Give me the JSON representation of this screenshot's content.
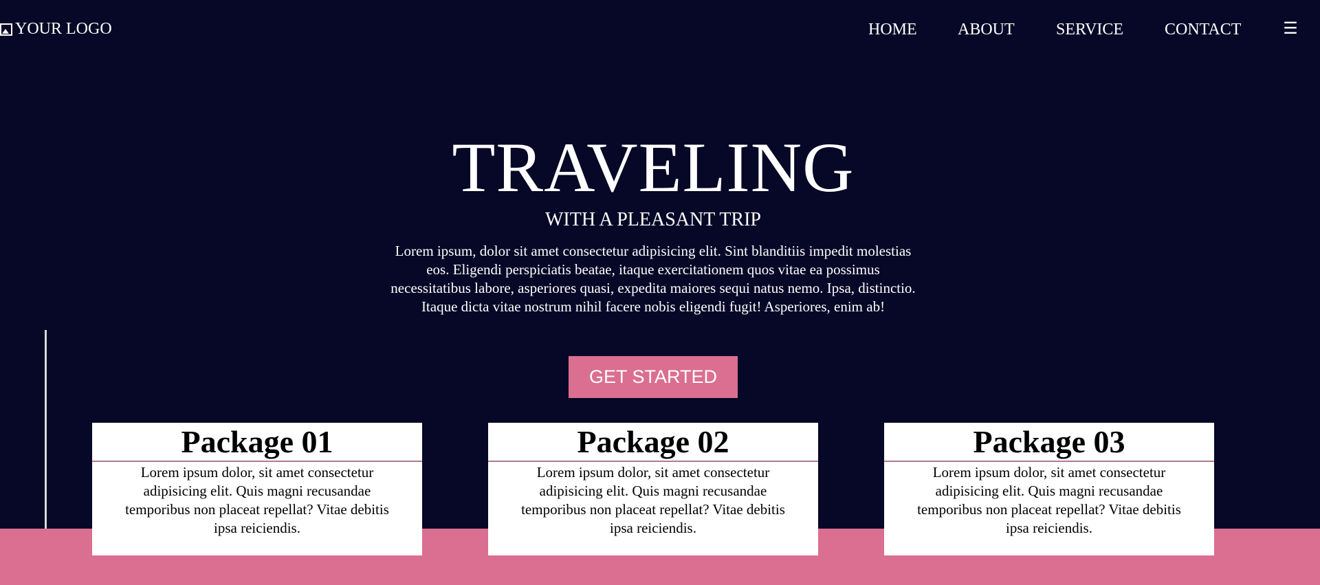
{
  "header": {
    "logo_text": "YOUR LOGO",
    "logo_icon": "image-icon",
    "nav": [
      {
        "label": "HOME"
      },
      {
        "label": "ABOUT"
      },
      {
        "label": "SERVICE"
      },
      {
        "label": "CONTACT"
      }
    ],
    "menu_icon": "☰"
  },
  "hero": {
    "title": "TRAVELING",
    "subtitle": "WITH A PLEASANT TRIP",
    "text": "Lorem ipsum, dolor sit amet consectetur adipisicing elit. Sint blanditiis impedit molestias eos. Eligendi perspiciatis beatae, itaque exercitationem quos vitae ea possimus necessitatibus labore, asperiores quasi, expedita maiores sequi natus nemo. Ipsa, distinctio. Itaque dicta vitae nostrum nihil facere nobis eligendi fugit! Asperiores, enim ab!",
    "cta_label": "GET STARTED"
  },
  "packages": [
    {
      "title": "Package 01",
      "text": "Lorem ipsum dolor, sit amet consectetur adipisicing elit. Quis magni recusandae temporibus non placeat repellat? Vitae debitis ipsa reiciendis."
    },
    {
      "title": "Package 02",
      "text": "Lorem ipsum dolor, sit amet consectetur adipisicing elit. Quis magni recusandae temporibus non placeat repellat? Vitae debitis ipsa reiciendis."
    },
    {
      "title": "Package 03",
      "text": "Lorem ipsum dolor, sit amet consectetur adipisicing elit. Quis magni recusandae temporibus non placeat repellat? Vitae debitis ipsa reiciendis."
    }
  ],
  "colors": {
    "background": "#070727",
    "accent": "#db6f91",
    "card_background": "#ffffff",
    "text_light": "#ffffff",
    "text_dark": "#000000"
  }
}
